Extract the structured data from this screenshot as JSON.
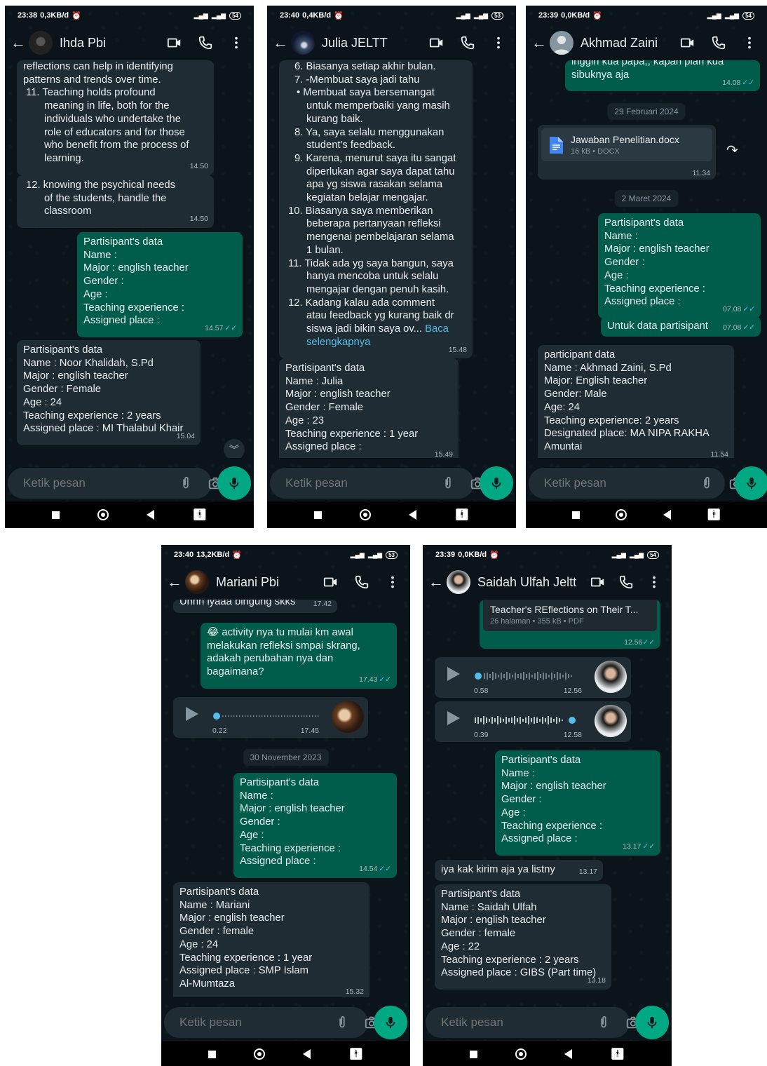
{
  "shared": {
    "input_placeholder": "Ketik pesan",
    "accent": "#00a884",
    "incoming_bubble": "#202c33",
    "outgoing_bubble": "#005c4b",
    "icons": [
      "back-arrow-icon",
      "video-call-icon",
      "voice-call-icon",
      "more-menu-icon",
      "emoji-icon",
      "attach-icon",
      "camera-icon",
      "mic-icon"
    ]
  },
  "template": {
    "title": "Partisipant's data",
    "name": "Name :",
    "major": "Major : english teacher",
    "gender": "Gender :",
    "age": "Age   :",
    "experience": "Teaching experience :",
    "place": "Assigned place :"
  },
  "ph1": {
    "time": "23:38",
    "net": "0,3KB/d",
    "battery": "54",
    "contact": "Ihda Pbi",
    "m1": {
      "lines": [
        "reflections can help in identifying",
        "patterns and trends over time.",
        "11. Teaching holds profound",
        "meaning in life, both for the",
        "individuals who undertake the",
        "role of educators and for those",
        "who benefit from the process of",
        "learning."
      ],
      "time": "14.50"
    },
    "m2": {
      "lines": [
        "12. knowing the psychical needs",
        "of the students, handle the",
        "classroom"
      ],
      "time": "14.50"
    },
    "m3": {
      "time": "14.57"
    },
    "m4": {
      "lines": [
        "Partisipant's data",
        "Name : Noor Khalidah, S.Pd",
        "Major : english teacher",
        "Gender : Female",
        "Age   : 24",
        "Teaching experience : 2 years",
        "Assigned place : MI Thalabul Khair"
      ],
      "time": "15.04"
    }
  },
  "ph2": {
    "time": "23:40",
    "net": "0,4KB/d",
    "battery": "53",
    "contact": "Julia JELTT",
    "m1": {
      "lines": [
        "6. Biasanya setiap akhir bulan.",
        "7. -Membuat saya jadi tahu",
        "•  Membuat saya bersemangat",
        "untuk memperbaiki yang masih",
        "kurang baik.",
        "8. Ya, saya selalu menggunakan",
        "student's feedback.",
        "9. Karena, menurut saya itu sangat",
        "diperlukan agar saya dapat tahu",
        "apa yg siswa rasakan selama",
        "kegiatan belajar mengajar.",
        "10. Biasanya saya memberikan",
        "beberapa pertanyaan refleksi",
        "mengenai pembelajaran selama",
        "1 bulan.",
        "11. Tidak ada yg saya bangun, saya",
        "hanya mencoba untuk selalu",
        "mengajar dengan penuh kasih.",
        "12. Kadang kalau ada comment",
        "atau feedback yg kurang baik dr",
        "siswa jadi bikin saya ov..."
      ],
      "read_more": "Baca",
      "read_more2": "selengkapnya",
      "time": "15.48"
    },
    "m2": {
      "lines": [
        "Partisipant's data",
        "Name : Julia",
        "Major : english teacher",
        "Gender : Female",
        "Age   : 23",
        "Teaching experience : 1 year",
        "Assigned place :"
      ],
      "time": "15.49"
    }
  },
  "ph3": {
    "time": "23:39",
    "net": "0,0KB/d",
    "battery": "54",
    "contact": "Akhmad Zaini",
    "m1": {
      "lines": [
        "inggih kua papa,, kapan plan kua",
        "sibuknya aja"
      ],
      "time": "14.08"
    },
    "date1": "29 Februari 2024",
    "doc": {
      "name": "Jawaban Penelitian.docx",
      "meta": "16 kB • DOCX",
      "time": "11.34"
    },
    "date2": "2 Maret 2024",
    "m2": {
      "time": "07.08"
    },
    "m3": {
      "text": "Untuk data partisipant",
      "time": "07.08"
    },
    "m4": {
      "lines": [
        "participant data",
        "Name : Akhmad Zaini, S.Pd",
        "Major: English teacher",
        "Gender: Male",
        "Age: 24",
        "Teaching experience: 2 years",
        "Designated place: MA NIPA RAKHA",
        "Amuntai"
      ],
      "time": "11.54"
    }
  },
  "ph4": {
    "time": "23:40",
    "net": "13,2KB/d",
    "battery": "53",
    "contact": "Mariani Pbi",
    "m0": {
      "text": "Uhhh iyaaa bingung skks",
      "time": "17.42"
    },
    "m1": {
      "emoji": "😂",
      "lines": [
        "activity nya tu mulai km awal",
        "melakukan refleksi smpai skrang,",
        "adakah perubahan nya dan",
        "bagaimana?"
      ],
      "time": "17.43"
    },
    "voice": {
      "duration": "0.22",
      "time": "17.45"
    },
    "date1": "30 November 2023",
    "m2": {
      "time": "14.54"
    },
    "m3": {
      "lines": [
        "Partisipant's data",
        "Name : Mariani",
        "Major : english teacher",
        "Gender : female",
        "Age   : 24",
        "Teaching experience :  1 year",
        "Assigned place : SMP Islam",
        "Al-Mumtaza"
      ],
      "time": "15.32"
    }
  },
  "ph5": {
    "time": "23:39",
    "net": "0,0KB/d",
    "battery": "54",
    "contact": "Saidah Ulfah Jeltt",
    "doc": {
      "name": "Teacher's REflections on Their T...",
      "meta": "26 halaman • 355 kB • PDF",
      "time": "12.56"
    },
    "voice1": {
      "duration": "0.58",
      "time": "12.56"
    },
    "voice2": {
      "duration": "0.39",
      "time": "12.58"
    },
    "m1": {
      "time": "13.17"
    },
    "m2": {
      "text": "iya kak kirim aja ya listny",
      "time": "13.17"
    },
    "m3": {
      "lines": [
        "Partisipant's data",
        "Name : Saidah Ulfah",
        "Major : english teacher",
        "Gender : female",
        "Age   : 22",
        "Teaching experience : 2 years",
        "Assigned place : GIBS (Part time)"
      ],
      "time": "13.18"
    }
  }
}
